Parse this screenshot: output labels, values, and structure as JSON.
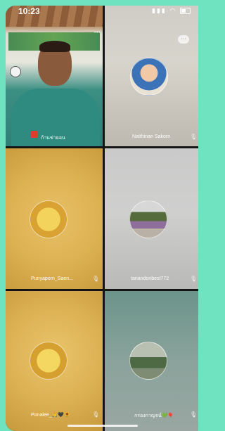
{
  "status": {
    "time": "10:23",
    "icons": "▲ ◠"
  },
  "participants": [
    {
      "name": "",
      "avatar": "host-video-feed",
      "shirt_text": "ก้านข่ายอน"
    },
    {
      "name": "Natthinan Sakorn",
      "avatar": "child-photo"
    },
    {
      "name": "Punyaporn_Saen...",
      "avatar": "banana-cartoon"
    },
    {
      "name": "tanandonbest772",
      "avatar": "group-photo"
    },
    {
      "name": "Panalee_🙏🖤🌻",
      "avatar": "banana-cartoon"
    },
    {
      "name": "กรองกาญจน์💚🎈",
      "avatar": "outdoor-photo"
    }
  ],
  "icons": {
    "mic": "mic-icon",
    "chat": "chat-bubble-icon"
  },
  "colors": {
    "background": "#6fe3bf",
    "tile_divider": "#151515",
    "yellow_tile": "#dcb152"
  }
}
